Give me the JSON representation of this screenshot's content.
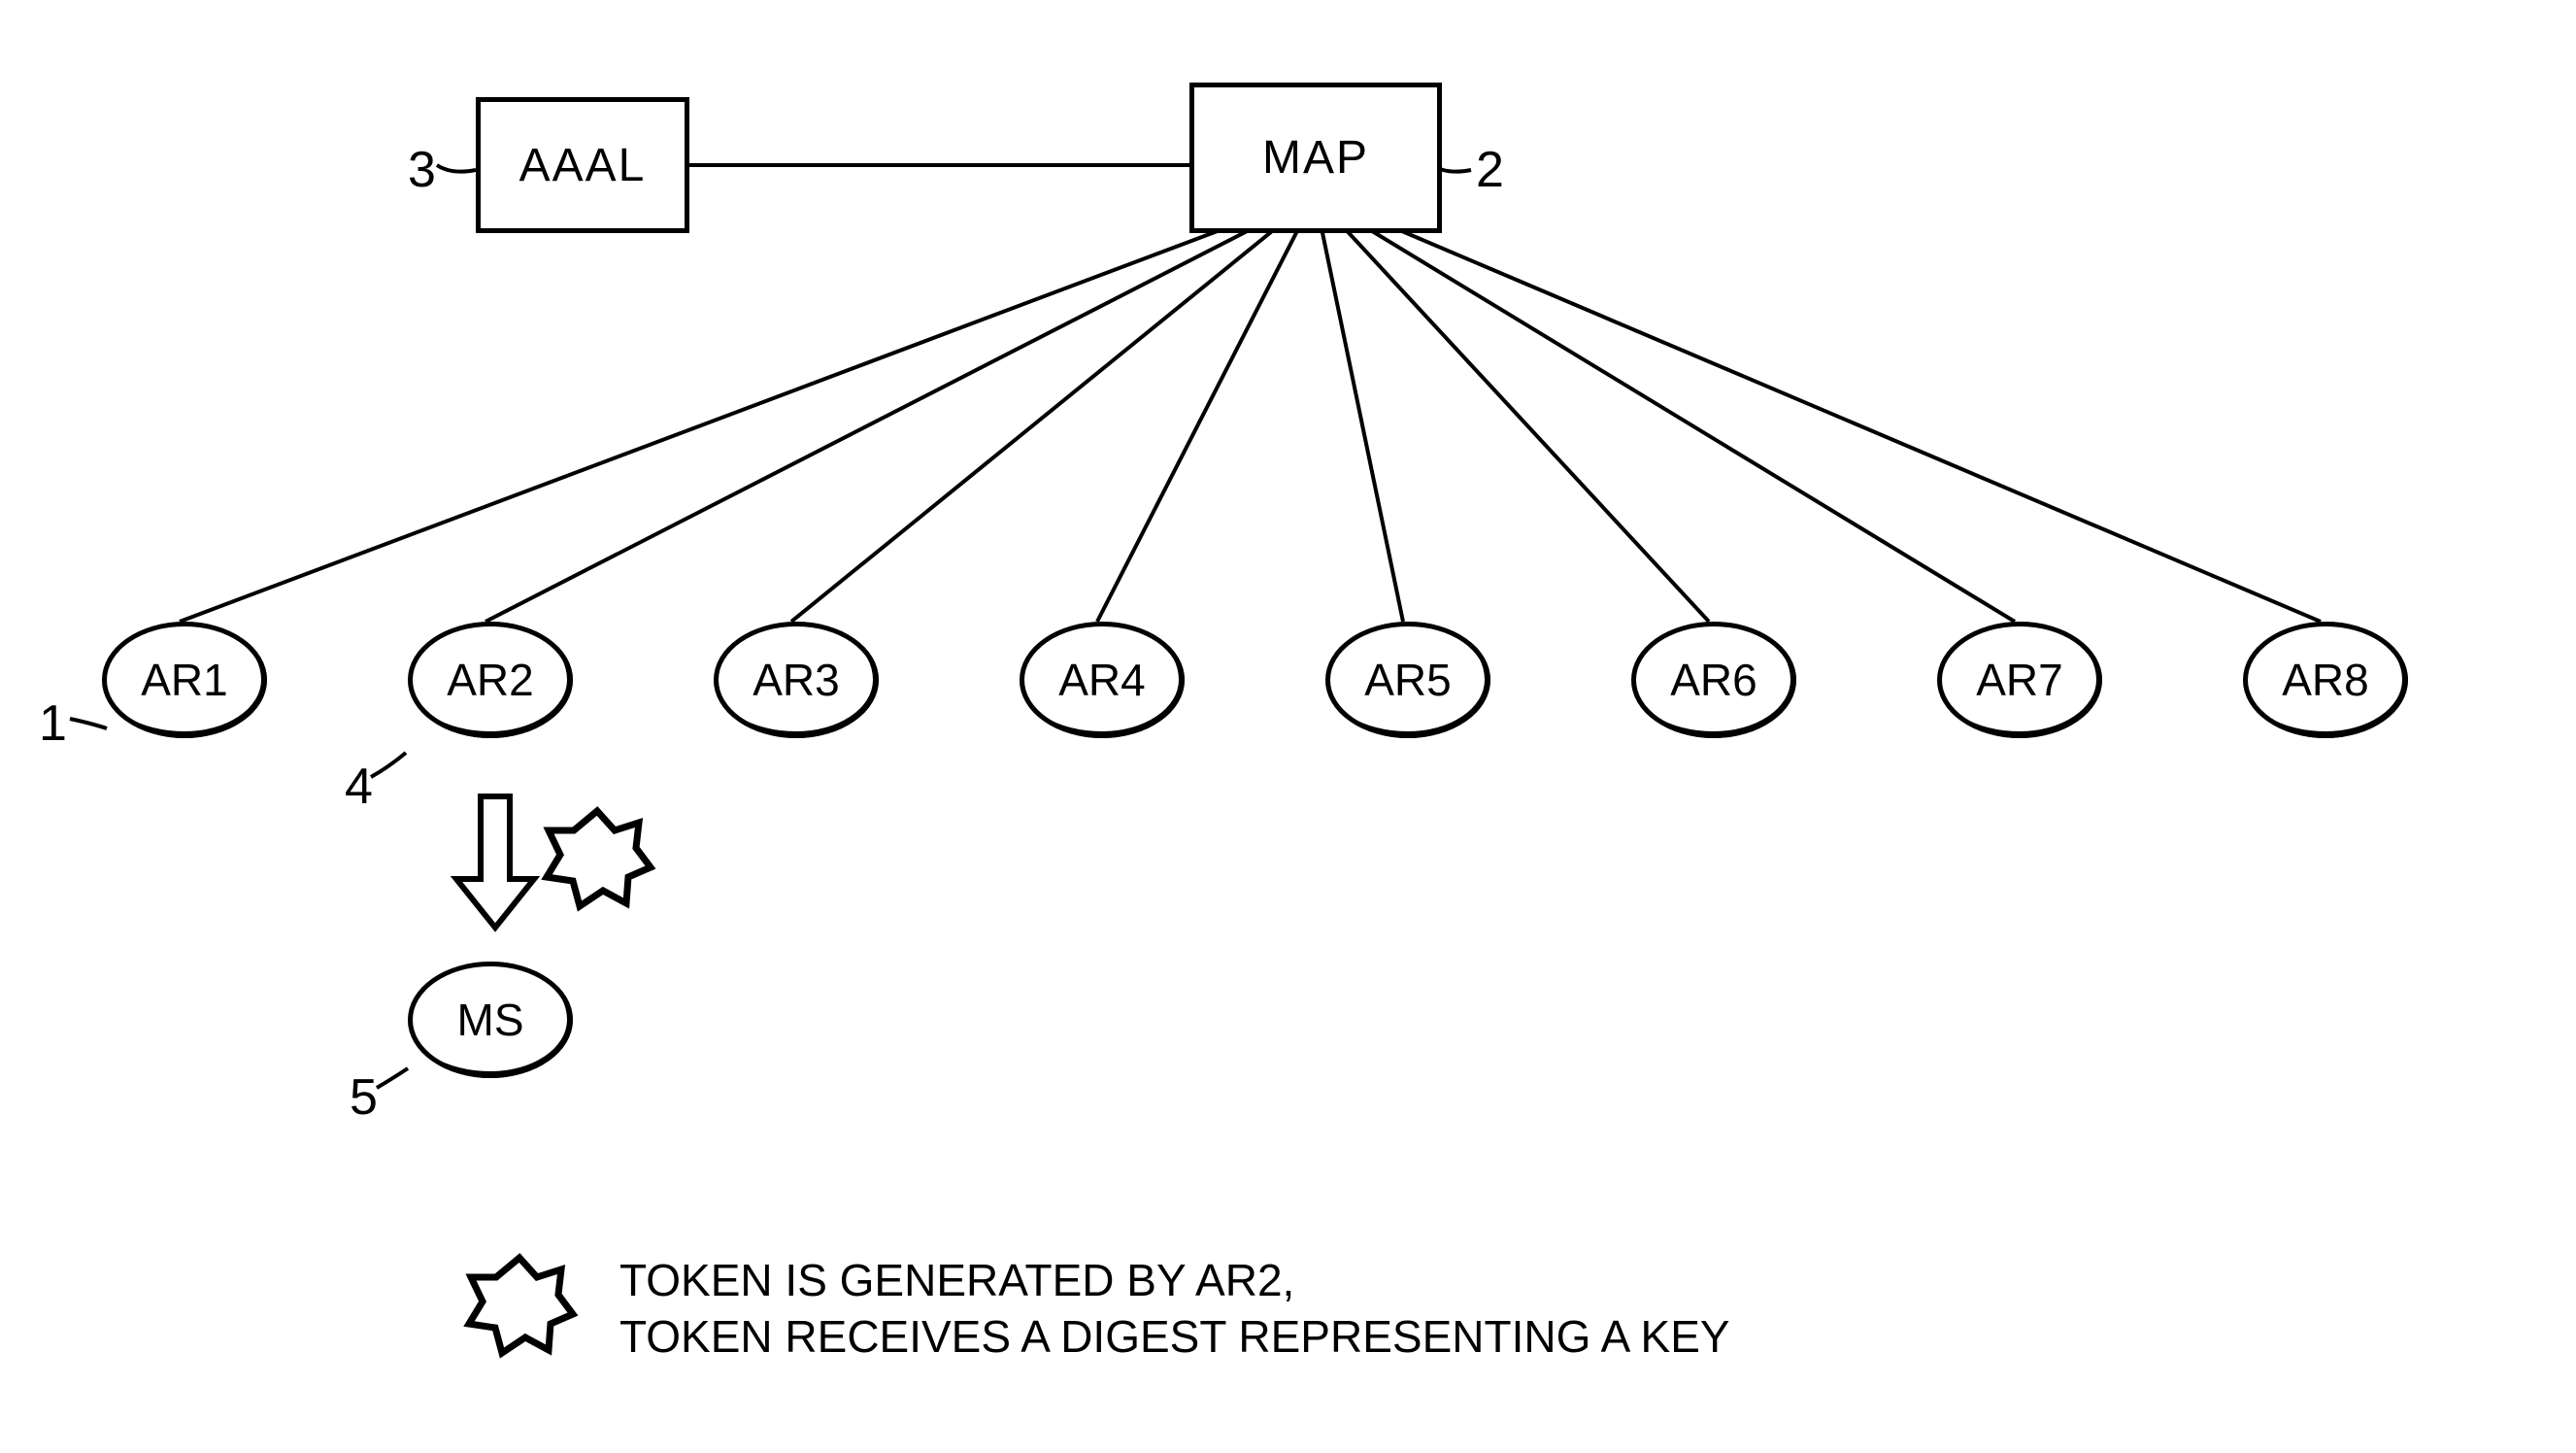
{
  "top": {
    "aaal": {
      "label": "AAAL",
      "ref": "3"
    },
    "map": {
      "label": "MAP",
      "ref": "2"
    }
  },
  "routers": [
    {
      "label": "AR1",
      "ref": "1"
    },
    {
      "label": "AR2",
      "ref": "4"
    },
    {
      "label": "AR3"
    },
    {
      "label": "AR4"
    },
    {
      "label": "AR5"
    },
    {
      "label": "AR6"
    },
    {
      "label": "AR7"
    },
    {
      "label": "AR8"
    }
  ],
  "ms": {
    "label": "MS",
    "ref": "5"
  },
  "legend": {
    "line1": "TOKEN IS GENERATED BY AR2,",
    "line2": "TOKEN RECEIVES A DIGEST REPRESENTING A KEY"
  }
}
